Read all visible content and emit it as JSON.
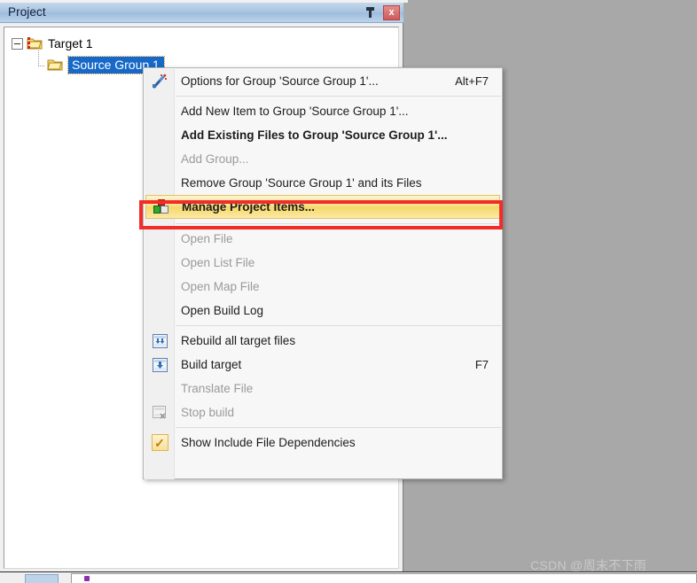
{
  "panel": {
    "title": "Project",
    "pin_icon": "pin-icon",
    "close_icon": "close-icon",
    "close_label": "x"
  },
  "tree": {
    "nodes": [
      {
        "label": "Target 1",
        "icon": "target-folder-icon",
        "level": 1,
        "selected": false,
        "expanded": true
      },
      {
        "label": "Source Group 1",
        "icon": "folder-icon",
        "level": 2,
        "selected": true,
        "expanded": false
      }
    ]
  },
  "context_menu": {
    "items": [
      {
        "type": "item",
        "label": "Options for Group 'Source Group 1'...",
        "accel": "Alt+F7",
        "icon": "magic-wand-icon",
        "disabled": false,
        "bold": false,
        "highlighted": false
      },
      {
        "type": "separator"
      },
      {
        "type": "item",
        "label": "Add New  Item to Group 'Source Group 1'...",
        "accel": "",
        "icon": "",
        "disabled": false,
        "bold": false,
        "highlighted": false
      },
      {
        "type": "item",
        "label": "Add Existing Files to Group 'Source Group 1'...",
        "accel": "",
        "icon": "",
        "disabled": false,
        "bold": true,
        "highlighted": false
      },
      {
        "type": "item",
        "label": "Add Group...",
        "accel": "",
        "icon": "",
        "disabled": true,
        "bold": false,
        "highlighted": false
      },
      {
        "type": "item",
        "label": "Remove Group 'Source Group 1' and its Files",
        "accel": "",
        "icon": "",
        "disabled": false,
        "bold": false,
        "highlighted": false
      },
      {
        "type": "item",
        "label": "Manage Project Items...",
        "accel": "",
        "icon": "project-items-blocks-icon",
        "disabled": false,
        "bold": true,
        "highlighted": true
      },
      {
        "type": "separator"
      },
      {
        "type": "item",
        "label": "Open File",
        "accel": "",
        "icon": "",
        "disabled": true,
        "bold": false,
        "highlighted": false
      },
      {
        "type": "item",
        "label": "Open List File",
        "accel": "",
        "icon": "",
        "disabled": true,
        "bold": false,
        "highlighted": false
      },
      {
        "type": "item",
        "label": "Open Map File",
        "accel": "",
        "icon": "",
        "disabled": true,
        "bold": false,
        "highlighted": false
      },
      {
        "type": "item",
        "label": "Open Build Log",
        "accel": "",
        "icon": "",
        "disabled": false,
        "bold": false,
        "highlighted": false
      },
      {
        "type": "separator"
      },
      {
        "type": "item",
        "label": "Rebuild all target files",
        "accel": "",
        "icon": "rebuild-icon",
        "disabled": false,
        "bold": false,
        "highlighted": false
      },
      {
        "type": "item",
        "label": "Build target",
        "accel": "F7",
        "icon": "build-icon",
        "disabled": false,
        "bold": false,
        "highlighted": false
      },
      {
        "type": "item",
        "label": "Translate File",
        "accel": "",
        "icon": "",
        "disabled": true,
        "bold": false,
        "highlighted": false
      },
      {
        "type": "item",
        "label": "Stop build",
        "accel": "",
        "icon": "stop-build-icon",
        "disabled": true,
        "bold": false,
        "highlighted": false
      },
      {
        "type": "separator"
      },
      {
        "type": "item",
        "label": "Show Include File Dependencies",
        "accel": "",
        "icon": "checkmark-icon",
        "disabled": false,
        "bold": false,
        "highlighted": false
      }
    ]
  },
  "annotation": {
    "highlight_color": "#f22c28",
    "target_label": "Manage Project Items..."
  },
  "watermark": {
    "text": "CSDN @周末不下雨"
  }
}
